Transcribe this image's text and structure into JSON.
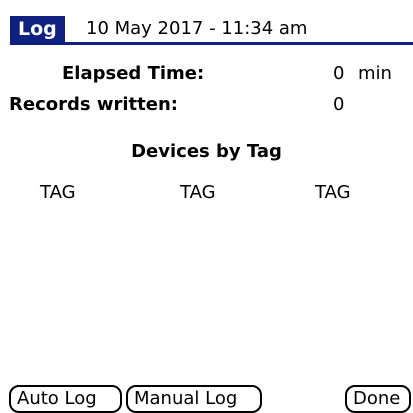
{
  "header": {
    "tab_label": "Log",
    "title": "10 May 2017 - 11:34 am"
  },
  "stats": {
    "elapsed_label": "Elapsed Time:",
    "elapsed_value": "0",
    "elapsed_unit": "min",
    "records_label": "Records written:",
    "records_value": "0"
  },
  "devices": {
    "heading": "Devices by Tag",
    "tags": [
      "TAG",
      "TAG",
      "TAG"
    ]
  },
  "buttons": {
    "auto_log": "Auto Log",
    "manual_log": "Manual Log",
    "done": "Done"
  },
  "colors": {
    "accent": "#10207e"
  }
}
